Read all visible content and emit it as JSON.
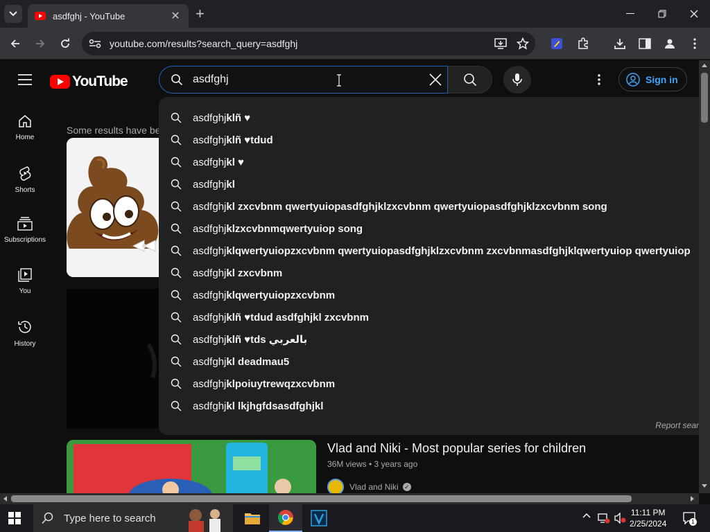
{
  "browser": {
    "tab_title": "asdfghj - YouTube",
    "url": "youtube.com/results?search_query=asdfghj"
  },
  "youtube": {
    "logo_text": "YouTube",
    "search_value": "asdfghj",
    "signin_label": "Sign in",
    "left_nav": [
      {
        "label": "Home",
        "icon": "home-icon"
      },
      {
        "label": "Shorts",
        "icon": "shorts-icon"
      },
      {
        "label": "Subscriptions",
        "icon": "subscriptions-icon"
      },
      {
        "label": "You",
        "icon": "you-icon"
      },
      {
        "label": "History",
        "icon": "history-icon"
      }
    ],
    "notice": "Some results have be",
    "suggestions": [
      {
        "typed": "asdfghj",
        "rest": "klñ ♥"
      },
      {
        "typed": "asdfghj",
        "rest": "klñ ♥tdud"
      },
      {
        "typed": "asdfghj",
        "rest": "kl ♥"
      },
      {
        "typed": "asdfghj",
        "rest": "kl"
      },
      {
        "typed": "asdfghj",
        "rest": "kl zxcvbnm qwertyuiopasdfghjklzxcvbnm qwertyuiopasdfghjklzxcvbnm song"
      },
      {
        "typed": "asdfghj",
        "rest": "klzxcvbnmqwertyuiop song"
      },
      {
        "typed": "asdfghj",
        "rest": "klqwertyuiopzxcvbnm qwertyuiopasdfghjklzxcvbnm zxcvbnmasdfghjklqwertyuiop qwertyuiop"
      },
      {
        "typed": "asdfghj",
        "rest": "kl zxcvbnm"
      },
      {
        "typed": "asdfghj",
        "rest": "klqwertyuiopzxcvbnm"
      },
      {
        "typed": "asdfghj",
        "rest": "klñ ♥tdud asdfghjkl zxcvbnm"
      },
      {
        "typed": "asdfghj",
        "rest": "klñ ♥tds بالعربي"
      },
      {
        "typed": "asdfghj",
        "rest": "kl deadmau5"
      },
      {
        "typed": "asdfghj",
        "rest": "klpoiuytrewqzxcvbnm"
      },
      {
        "typed": "asdfghj",
        "rest": "kl lkjhgfdsasdfghjkl"
      }
    ],
    "report_label": "Report sear",
    "video": {
      "title": "Vlad and Niki - Most popular series for children",
      "meta": "36M views • 3 years ago",
      "channel": "Vlad and Niki"
    }
  },
  "taskbar": {
    "search_placeholder": "Type here to search",
    "time": "11:11 PM",
    "date": "2/25/2024",
    "notification_count": "1"
  },
  "colors": {
    "brand_red": "#ff0000",
    "link_blue": "#3ea6ff",
    "focus_blue": "#1c62b9"
  }
}
